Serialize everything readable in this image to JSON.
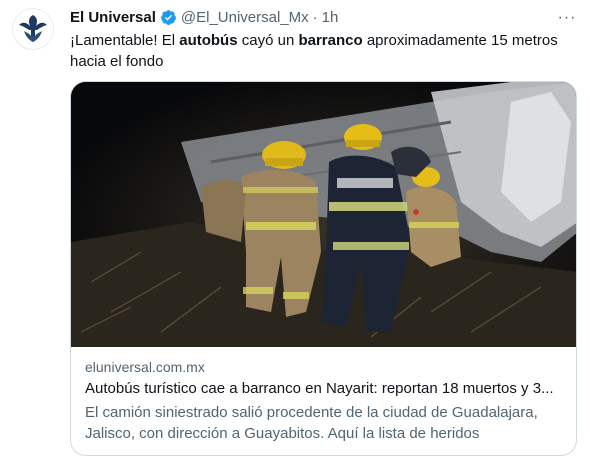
{
  "tweet": {
    "display_name": "El Universal",
    "handle": "@El_Universal_Mx",
    "separator": "·",
    "time": "1h",
    "more_label": "···",
    "text": {
      "p1": "¡Lamentable! El ",
      "b1": "autobús",
      "p2": " cayó un ",
      "b2": "barranco",
      "p3": " aproximadamente 15 metros hacia el fondo"
    }
  },
  "card": {
    "domain": "eluniversal.com.mx",
    "title": "Autobús turístico cae a barranco en Nayarit: reportan 18 muertos y 3...",
    "description": "El camión siniestrado salió procedente de la ciudad de Guadalajara, Jalisco, con dirección a Guayabitos. Aquí la lista de heridos"
  },
  "colors": {
    "verified": "#1d9bf0",
    "text": "#0f1419",
    "secondary": "#536471",
    "border": "#cfd9de",
    "helmet": "#f2c21a"
  },
  "icons": {
    "verified": "verified-badge-icon",
    "more": "more-dots-icon",
    "avatar": "eagle-logo"
  }
}
